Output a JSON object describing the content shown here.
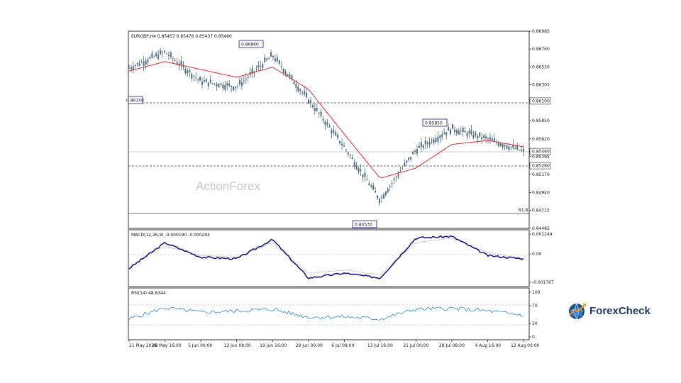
{
  "header": {
    "symbol_line": "EURGBP,H4  0.85457 0.85476 0.85437 0.85460"
  },
  "watermark": "ActionForex",
  "brand": {
    "name": "ForexCheck",
    "icon": "globe-chart-icon"
  },
  "colors": {
    "candle": "#4e6e80",
    "ma": "#e03030",
    "macd": "#1a1a8c",
    "macd_signal": "#aaaaaa",
    "rsi": "#2a8ee0",
    "level_box": "#1a1a8c"
  },
  "chart_data": [
    {
      "type": "line",
      "panel": "price",
      "pair": "EURGBP",
      "timeframe": "H4",
      "ohlc": {
        "open": 0.85457,
        "high": 0.85476,
        "low": 0.85437,
        "close": 0.8546
      },
      "x": [
        "21 May 2026",
        "28 May 16:00",
        "5 Jun 00:00",
        "12 Jun 08:00",
        "19 Jun 16:00",
        "29 Jun 00:00",
        "6 Jul 08:00",
        "13 Jul 16:00",
        "21 Jul 00:00",
        "28 Jul 08:00",
        "4 Aug 16:00",
        "12 Aug 00:00"
      ],
      "series": [
        {
          "values": [
            0.8652,
            0.8672,
            0.8635,
            0.8628,
            0.8668,
            0.8612,
            0.8552,
            0.8485,
            0.8548,
            0.8575,
            0.8562,
            0.8546
          ]
        },
        {
          "values": [
            0.8648,
            0.866,
            0.865,
            0.864,
            0.8653,
            0.8625,
            0.8568,
            0.8512,
            0.8525,
            0.8555,
            0.856,
            0.8552
          ]
        }
      ],
      "ylim": [
        0.84485,
        0.86985
      ],
      "ticks": [
        "0.86985",
        "0.86760",
        "0.86530",
        "0.86305",
        "0.86100",
        "0.85850",
        "0.85620",
        "0.85460",
        "0.85395",
        "0.85280",
        "0.85170",
        "0.84940",
        "0.84715",
        "0.84485"
      ],
      "annotations": [
        "0.86860",
        "0.85850",
        "0.84530",
        "0.86150"
      ],
      "levels": [
        {
          "value": 0.861,
          "label": "0.86100",
          "style": "dashed"
        },
        {
          "value": 0.8528,
          "label": "0.85280",
          "style": "dashed"
        },
        {
          "value": 0.8546,
          "label": "0.85460",
          "style": "solid"
        },
        {
          "value": 0.8471,
          "label": "61.8",
          "style": "solid"
        }
      ]
    },
    {
      "type": "line",
      "panel": "macd",
      "title": "MACD(12,26,9) -0.000190 -0.000294",
      "series": [
        {
          "values": [
            -0.0009,
            0.0007,
            -0.0002,
            -0.0003,
            0.0009,
            -0.0015,
            -0.0012,
            -0.0015,
            0.001,
            0.0011,
            -0.0001,
            -0.0003
          ]
        },
        {
          "values": [
            -0.0008,
            0.0005,
            -0.0001,
            -0.0002,
            0.0007,
            -0.0012,
            -0.001,
            -0.0013,
            0.0007,
            0.001,
            0.0001,
            -0.0003
          ]
        }
      ],
      "ylim": [
        -0.001767,
        0.001244
      ],
      "ticks": [
        "0.001244",
        "0.00",
        "-0.001767"
      ]
    },
    {
      "type": "line",
      "panel": "rsi",
      "title": "RSI(14) 48.6344",
      "series": [
        {
          "values": [
            40,
            65,
            55,
            58,
            62,
            44,
            45,
            40,
            62,
            64,
            58,
            48.6
          ]
        }
      ],
      "ylim": [
        0,
        100
      ],
      "ticks": [
        "100",
        "70",
        "30",
        "0"
      ]
    }
  ]
}
